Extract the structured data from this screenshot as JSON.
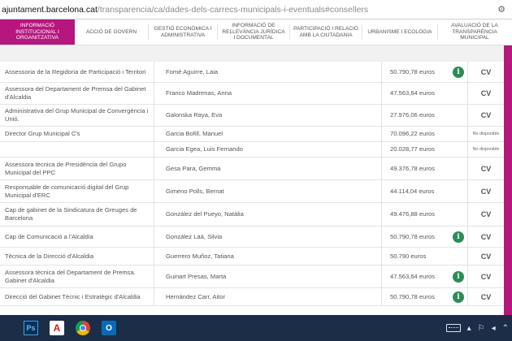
{
  "address_bar": {
    "host": "ajuntament.barcelona.cat",
    "path": "/transparencia/ca/dades-dels-carrecs-municipals-i-eventuals#consellers",
    "icon": "extension-icon"
  },
  "nav": {
    "tabs": [
      {
        "label": "INFORMACIÓ INSTITUCIONAL I ORGANITZATIVA",
        "active": true
      },
      {
        "label": "ACCIÓ DE GOVERN"
      },
      {
        "label": "GESTIÓ ECONÒMICA I ADMINISTRATIVA"
      },
      {
        "label": "INFORMACIÓ DE RELLEVÀNCIA JURÍDICA I DOCUMENTAL"
      },
      {
        "label": "PARTICIPACIÓ I RELACIÓ AMB LA CIUTADANIA"
      },
      {
        "label": "URBANISME I ECOLOGIA"
      },
      {
        "label": "AVALUACIÓ DE LA TRANSPARÈNCIA MUNICIPAL"
      }
    ]
  },
  "table": {
    "rows": [
      {
        "role": "Assessoria de la Regidoria de Participació i Territori",
        "name": "Fomé Aguirre, Laia",
        "salary": "50.790,78 euros",
        "info": true,
        "cv": "CV"
      },
      {
        "role": "Assessora del Departament de Premsa del Gabinet d'Alcaldia",
        "name": "Franco Madrenas, Anna",
        "salary": "47.563,64 euros",
        "info": false,
        "cv": "CV"
      },
      {
        "role": "Administrativa del Grup Municipal de Convergència i Unió.",
        "name": "Galonska Raya, Eva",
        "salary": "27.976,06 euros",
        "info": false,
        "cv": "CV"
      },
      {
        "role": "Director Grup Municipal C's",
        "name": "Garcia Bofill, Manuel",
        "salary": "70.096,22 euros",
        "info": false,
        "cv": "No disponible"
      },
      {
        "role": "",
        "name": "Garcia Egea, Luis Fernando",
        "salary": "20.028,77 euros",
        "info": false,
        "cv": "No disponible"
      },
      {
        "role": "Assessora tècnica de Presidència del Grupo Municipal del PPC",
        "name": "Gesa Para, Gemma",
        "salary": "49.376,78 euros",
        "info": false,
        "cv": "CV"
      },
      {
        "role": "Responsable de comunicació digital del Grup Municipal d'ERC",
        "name": "Gimeno Polls, Bernat",
        "salary": "44.114,04 euros",
        "info": false,
        "cv": "CV"
      },
      {
        "role": "Cap de gabinet de la Sindicatura de Greuges de Barcelona",
        "name": "González del Pueyo, Natàlia",
        "salary": "49.476,88 euros",
        "info": false,
        "cv": "CV"
      },
      {
        "role": "Cap de Comunicació a l'Alcaldia",
        "name": "González Laá, Silvia",
        "salary": "50.790,78 euros",
        "info": true,
        "cv": "CV"
      },
      {
        "role": "Tècnica de la Direcció d'Alcaldia",
        "name": "Guerrero Muñoz, Tatiana",
        "salary": "50.790 euros",
        "info": false,
        "cv": "CV"
      },
      {
        "role": "Assessora tècnica del Departament de Premsa. Gabinet d'Alcaldia",
        "name": "Guinart Presas, Marta",
        "salary": "47.563,64 euros",
        "info": true,
        "cv": "CV"
      },
      {
        "role": "Direcció del Gabinet Tècnic i Estratègic d'Alcaldia",
        "name": "Hernández Carr, Aitor",
        "salary": "50.790,78 euros",
        "info": true,
        "cv": "CV"
      }
    ]
  },
  "taskbar": {
    "apps": [
      {
        "name": "photoshop-icon",
        "label": "Ps"
      },
      {
        "name": "acrobat-icon",
        "label": "A"
      },
      {
        "name": "chrome-icon",
        "label": ""
      },
      {
        "name": "outlook-icon",
        "label": "O"
      }
    ],
    "tray": {
      "lang": "",
      "glyphs": [
        "▴",
        "⚐",
        "◂",
        "⌃"
      ]
    }
  },
  "colors": {
    "accent": "#b5177e",
    "info_badge": "#2e8b57",
    "taskbar": "#1c2d47"
  }
}
